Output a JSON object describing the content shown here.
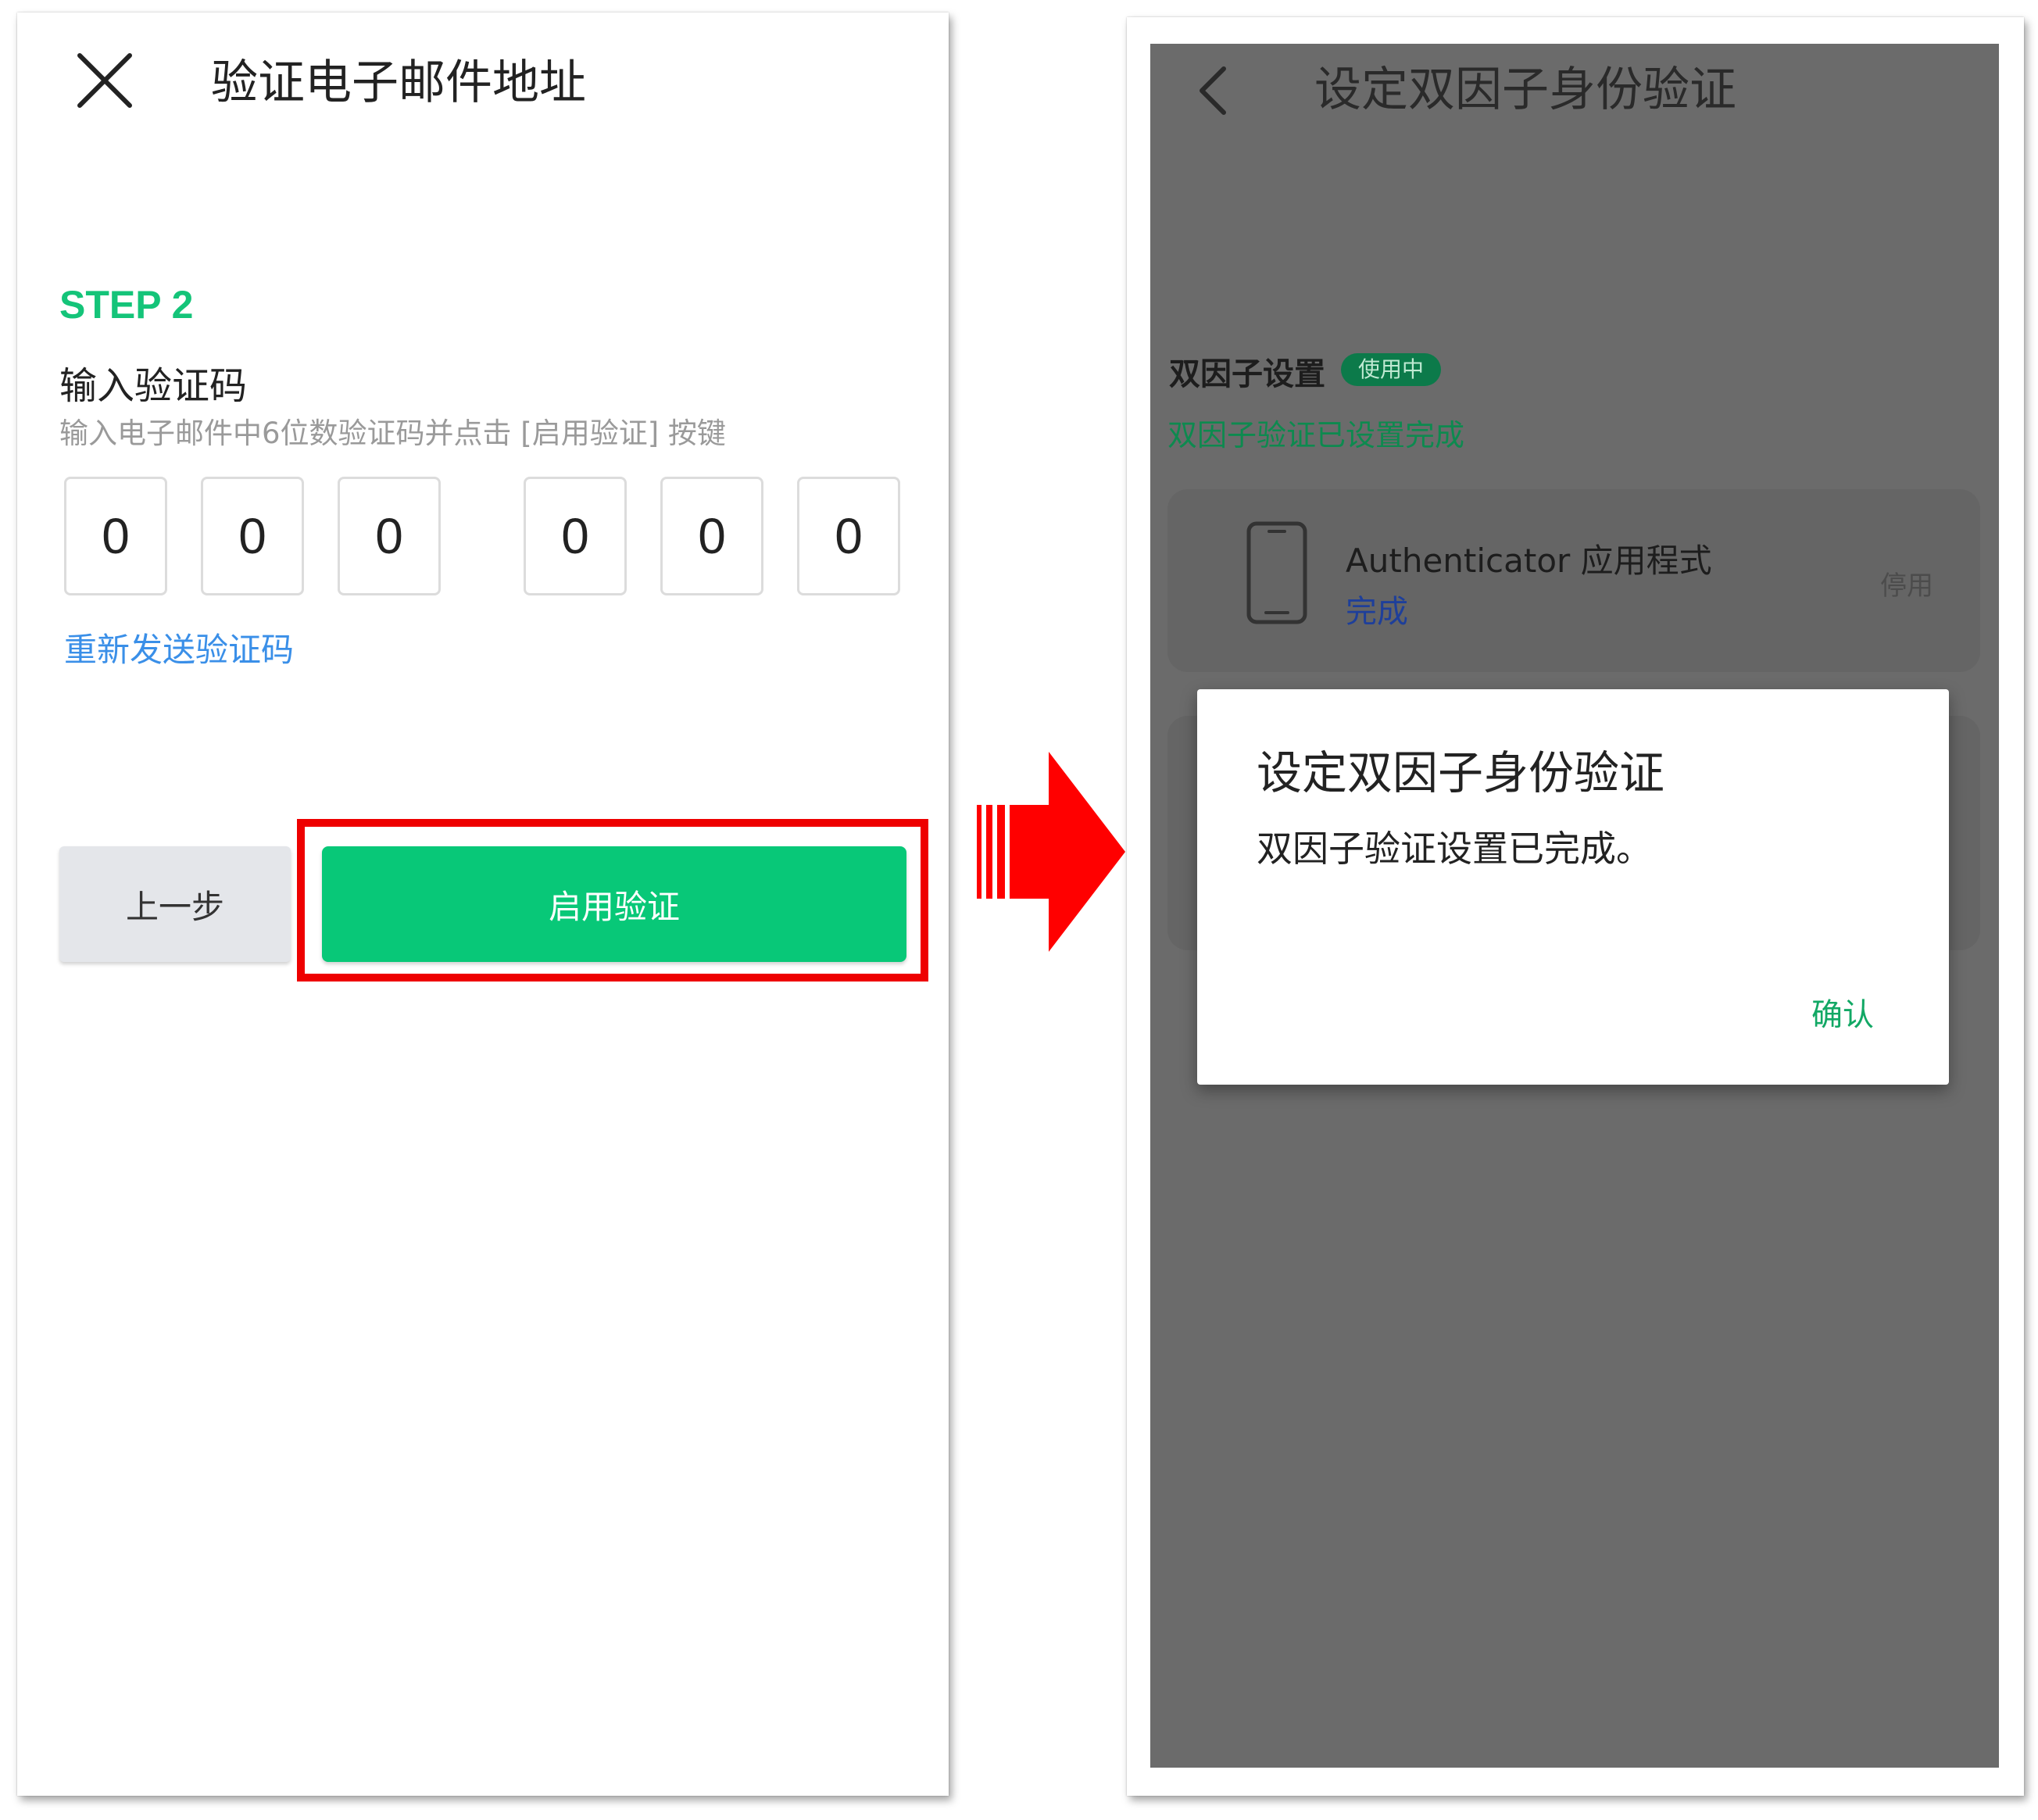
{
  "left_screen": {
    "title": "验证电子邮件地址",
    "step_label": "STEP 2",
    "section_title": "输入验证码",
    "section_description": "输入电子邮件中6位数验证码并点击 [启用验证] 按键",
    "code_digits": [
      "0",
      "0",
      "0",
      "0",
      "0",
      "0"
    ],
    "resend_link": "重新发送验证码",
    "prev_button": "上一步",
    "enable_button": "启用验证",
    "icons": {
      "close": "close-icon"
    },
    "colors": {
      "accent_green": "#08c878",
      "link_blue": "#3a8fe8",
      "highlight_red": "#ee0000"
    }
  },
  "arrow": {
    "icon": "right-arrow-icon",
    "color": "#ff0000"
  },
  "right_screen": {
    "title": "设定双因子身份验证",
    "settings_label": "双因子设置",
    "in_use_badge": "使用中",
    "status_text": "双因子验证已设置完成",
    "authenticator": {
      "name": "Authenticator 应用程式",
      "status": "完成",
      "disable_link": "停用",
      "icon": "phone-icon"
    },
    "dialog": {
      "title": "设定双因子身份验证",
      "message": "双因子验证设置已完成。",
      "confirm_button": "确认"
    },
    "icons": {
      "back": "back-arrow-icon"
    },
    "colors": {
      "overlay_gray": "#6b6b6b",
      "confirm_green": "#12a865",
      "badge_green": "#0c7a4a"
    }
  }
}
